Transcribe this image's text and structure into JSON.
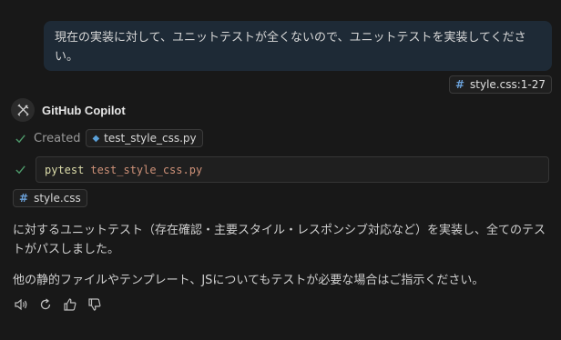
{
  "user_message": {
    "text": "現在の実装に対して、ユニットテストが全くないので、ユニットテストを実装してください。"
  },
  "context_ref": {
    "icon": "#",
    "label": "style.css:1-27"
  },
  "agent": {
    "name": "GitHub Copilot",
    "avatar_icon": "copilot-tools-icon"
  },
  "created": {
    "label": "Created",
    "file": "test_style_css.py"
  },
  "terminal": {
    "command": "pytest",
    "argument": "test_style_css.py"
  },
  "file_ref": {
    "icon": "#",
    "label": "style.css"
  },
  "response": {
    "paragraph1": "に対するユニットテスト（存在確認・主要スタイル・レスポンシブ対応など）を実装し、全てのテストがパスしました。",
    "paragraph2": "他の静的ファイルやテンプレート、JSについてもテストが必要な場合はご指示ください。"
  },
  "actions": [
    "speaker-icon",
    "retry-icon",
    "thumbs-up-icon",
    "thumbs-down-icon"
  ],
  "colors": {
    "background": "#181818",
    "user_bubble": "#1e2a36",
    "check": "#4e9a6b",
    "command": "#dcdcaa",
    "argument": "#ce9178"
  }
}
